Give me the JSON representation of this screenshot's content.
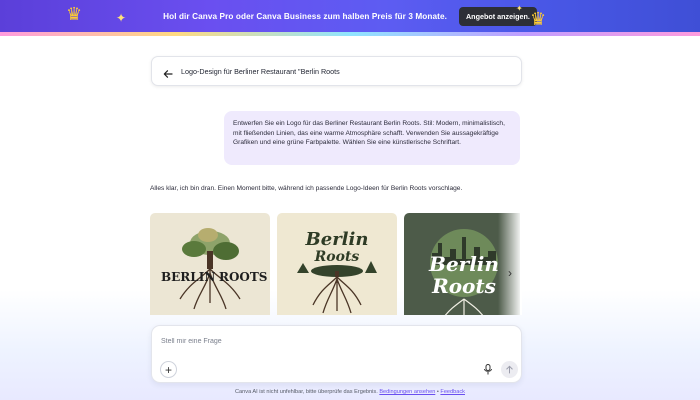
{
  "promo": {
    "text": "Hol dir Canva Pro oder Canva Business zum halben Preis für 3 Monate.",
    "button_label": "Angebot anzeigen."
  },
  "header": {
    "title": "Logo-Design für Berliner Restaurant \"Berlin Roots"
  },
  "conversation": {
    "user_message": "Entwerfen Sie ein Logo für das Berliner Restaurant Berlin Roots. Stil: Modern, minimalistisch, mit fließenden Linien, das eine warme Atmosphäre schafft. Verwenden Sie aussagekräftige Grafiken und eine grüne Farbpalette. Wählen Sie eine künstlerische Schriftart.",
    "assistant_message": "Alles klar, ich bin dran. Einen Moment bitte, während ich passende Logo-Ideen für Berlin Roots vorschlage."
  },
  "logos": [
    {
      "line1": "BERLIN",
      "line2": "ROOTS"
    },
    {
      "line1": "Berlin",
      "line2": "Roots"
    },
    {
      "line1": "Berlin",
      "line2": "Roots"
    }
  ],
  "input": {
    "placeholder": "Stell mir eine Frage",
    "value": ""
  },
  "footer": {
    "disclaimer": "Canva AI ist nicht unfehlbar, bitte überprüfe das Ergebnis.",
    "terms_link": "Bedingungen ansehen",
    "separator": "•",
    "feedback_link": "Feedback"
  },
  "colors": {
    "accent": "#6a4ff0",
    "user_bubble": "#efeafd",
    "dark_button": "#2d2f36"
  },
  "icons": {
    "back": "arrow-left-icon",
    "next": "chevron-right-icon",
    "plus": "plus-icon",
    "mic": "microphone-icon",
    "send": "arrow-up-icon"
  }
}
